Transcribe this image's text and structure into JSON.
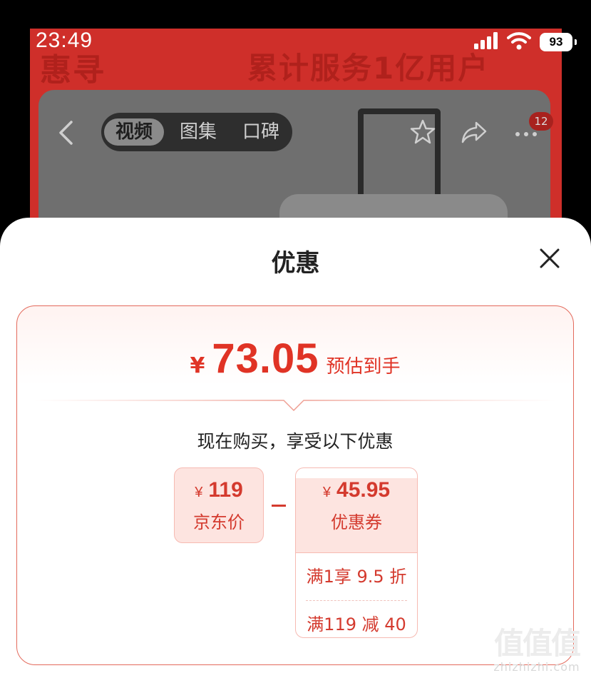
{
  "status_bar": {
    "time": "23:49",
    "battery": "93"
  },
  "background": {
    "banner_left": "惠寻",
    "banner_right": "累计服务1亿用户",
    "tabs": [
      "视频",
      "图集",
      "口碑"
    ],
    "active_tab": "视频",
    "badge_count": "12",
    "icons": [
      "back-icon",
      "star-icon",
      "share-icon",
      "more-icon"
    ]
  },
  "sheet": {
    "title": "优惠",
    "price": {
      "currency": "¥",
      "amount": "73.05",
      "label": "预估到手"
    },
    "intro": "现在购买，享受以下优惠",
    "jd_price": {
      "currency": "¥",
      "amount": "119",
      "label": "京东价"
    },
    "coupon": {
      "currency": "¥",
      "amount": "45.95",
      "label": "优惠券",
      "items": [
        "满1享 9.5 折",
        "满119 减 40"
      ]
    }
  },
  "watermark": {
    "logo": "值值值",
    "site": "zhizhizhi.com"
  },
  "colors": {
    "accent": "#e03325",
    "panel_border": "#e36a5c",
    "chip_bg": "#fde4e0"
  }
}
